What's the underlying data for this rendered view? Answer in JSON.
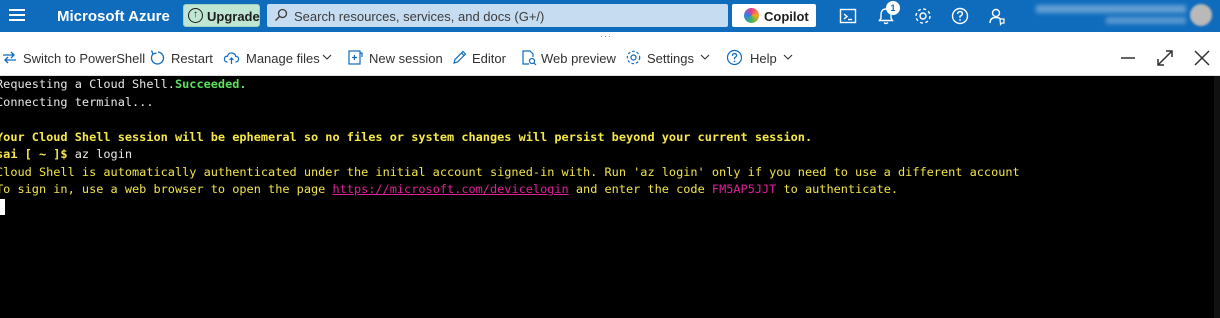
{
  "topbar": {
    "brand": "Microsoft Azure",
    "upgrade_label": "Upgrade",
    "search_placeholder": "Search resources, services, and docs (G+/)",
    "copilot_label": "Copilot",
    "notification_count": "1",
    "icons": [
      "menu-icon",
      "upgrade-icon",
      "search-icon",
      "copilot-icon",
      "cloud-shell-icon",
      "notifications-icon",
      "settings-icon",
      "help-icon",
      "feedback-icon"
    ]
  },
  "shellbar": {
    "switch_label": "Switch to PowerShell",
    "restart_label": "Restart",
    "manage_files_label": "Manage files",
    "new_session_label": "New session",
    "editor_label": "Editor",
    "web_preview_label": "Web preview",
    "settings_label": "Settings",
    "help_label": "Help",
    "grip": "···"
  },
  "terminal": {
    "line1_text": "Requesting a Cloud Shell.",
    "line1_status": "Succeeded.",
    "line2": "Connecting terminal...",
    "line3": "Your Cloud Shell session will be ephemeral so no files or system changes will persist beyond your current session.",
    "prompt": "sai [ ~ ]$",
    "command": " az login",
    "line5": "Cloud Shell is automatically authenticated under the initial account signed-in with. Run 'az login' only if you need to use a different account",
    "line6_pre": "To sign in, use a web browser to open the page ",
    "line6_link": "https://microsoft.com/devicelogin",
    "line6_mid": " and enter the code ",
    "line6_code": "FM5AP5JJT",
    "line6_post": " to authenticate."
  },
  "colors": {
    "azure_blue": "#0f6cbd",
    "success_green": "#5ee05e",
    "warning_yellow": "#f5e84a",
    "link_magenta": "#e0209a"
  }
}
